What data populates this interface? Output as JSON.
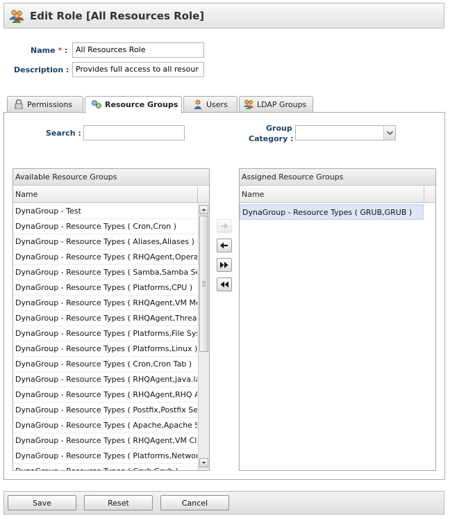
{
  "header": {
    "title": "Edit Role [All Resources Role]",
    "icon": "role-users-icon"
  },
  "form": {
    "name_label": "Name",
    "required_marker": "*",
    "name_colon": ":",
    "name_value": "All Resources Role",
    "description_label": "Description :",
    "description_value": "Provides full access to all resour"
  },
  "tabs": [
    {
      "label": "Permissions",
      "icon": "lock-icon",
      "active": false
    },
    {
      "label": "Resource Groups",
      "icon": "resource-group-icon",
      "active": true
    },
    {
      "label": "Users",
      "icon": "user-icon",
      "active": false
    },
    {
      "label": "LDAP Groups",
      "icon": "ldap-group-icon",
      "active": false
    }
  ],
  "filters": {
    "search_label": "Search :",
    "search_value": "",
    "group_category_label_1": "Group",
    "group_category_label_2": "Category :",
    "group_category_value": ""
  },
  "available": {
    "title": "Available Resource Groups",
    "column_header": "Name",
    "rows": [
      "DynaGroup - Test",
      "DynaGroup - Resource Types ( Cron,Cron )",
      "DynaGroup - Resource Types ( Aliases,Aliases )",
      "DynaGroup - Resource Types ( RHQAgent,Operating System )",
      "DynaGroup - Resource Types ( Samba,Samba Server )",
      "DynaGroup - Resource Types ( Platforms,CPU )",
      "DynaGroup - Resource Types ( RHQAgent,VM Memory )",
      "DynaGroup - Resource Types ( RHQAgent,Threading )",
      "DynaGroup - Resource Types ( Platforms,File System )",
      "DynaGroup - Resource Types ( Platforms,Linux )",
      "DynaGroup - Resource Types ( Cron,Cron Tab )",
      "DynaGroup - Resource Types ( RHQAgent,java.lang )",
      "DynaGroup - Resource Types ( RHQAgent,RHQ Agent )",
      "DynaGroup - Resource Types ( Postfix,Postfix Server )",
      "DynaGroup - Resource Types ( Apache,Apache Server )",
      "DynaGroup - Resource Types ( RHQAgent,VM Class Loading )",
      "DynaGroup - Resource Types ( Platforms,Network Adapter )",
      "DynaGroup - Resource Types ( Grub,Grub )"
    ]
  },
  "assigned": {
    "title": "Assigned Resource Groups",
    "column_header": "Name",
    "rows": [
      "DynaGroup - Resource Types ( GRUB,GRUB )"
    ]
  },
  "mover_buttons": [
    {
      "name": "move-right-icon",
      "enabled": false
    },
    {
      "name": "move-left-icon",
      "enabled": true
    },
    {
      "name": "move-all-right-icon",
      "enabled": true
    },
    {
      "name": "move-all-left-icon",
      "enabled": true
    }
  ],
  "footer": {
    "save_label": "Save",
    "reset_label": "Reset",
    "cancel_label": "Cancel"
  }
}
